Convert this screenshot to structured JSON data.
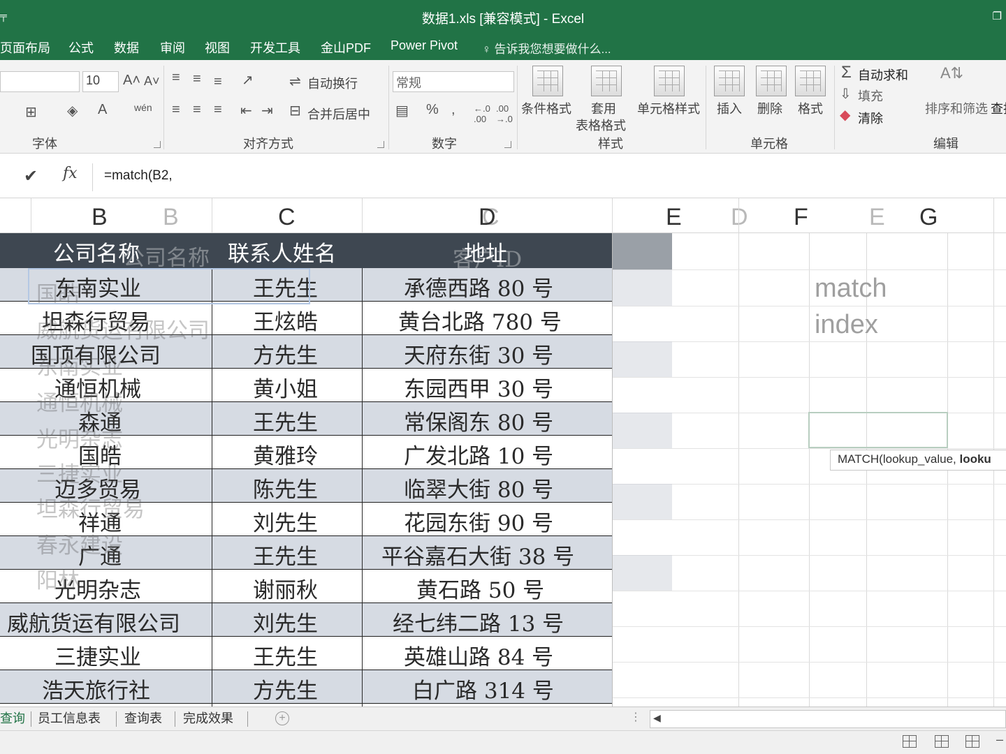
{
  "window": {
    "title": "数据1.xls  [兼容模式] - Excel",
    "left_glyph": "╤",
    "restore_glyph": "❐"
  },
  "menu_tabs": [
    "页面布局",
    "公式",
    "数据",
    "审阅",
    "视图",
    "开发工具",
    "金山PDF",
    "Power Pivot"
  ],
  "tell_me": "告诉我您想要做什么...",
  "ribbon": {
    "font_size": "10",
    "number_format": "常规",
    "wrap_text": "自动换行",
    "merge_center": "合并后居中",
    "cond_format": "条件格式",
    "table_format_1": "套用",
    "table_format_2": "表格格式",
    "cell_styles": "单元格样式",
    "insert": "插入",
    "delete": "删除",
    "format": "格式",
    "autosum": "自动求和",
    "fill": "填充",
    "clear": "清除",
    "sort_filter": "排序和筛选",
    "find": "查找",
    "groups": {
      "font": "字体",
      "alignment": "对齐方式",
      "number": "数字",
      "styles": "样式",
      "cells": "单元格",
      "editing": "编辑"
    }
  },
  "formula_bar": {
    "check": "✔",
    "fx": "fx",
    "formula": "=match(B2,"
  },
  "columns": {
    "B": "B",
    "B_ghost": "B",
    "C": "C",
    "D": "D",
    "C_ghost": "C",
    "E": "E",
    "D_ghost": "D",
    "F": "F",
    "E_ghost": "E",
    "G": "G"
  },
  "table": {
    "headers": {
      "company": "公司名称",
      "company_ghost": "公司名称",
      "contact": "联系人姓名",
      "address": "地址",
      "address_ghost": "客户ID"
    },
    "rows": [
      {
        "company": "东南实业",
        "contact": "王先生",
        "address": "承德西路 80 号"
      },
      {
        "company": "坦森行贸易",
        "contact": "王炫皓",
        "address": "黄台北路 780 号"
      },
      {
        "company": "国顶有限公司",
        "contact": "方先生",
        "address": "天府东街 30 号"
      },
      {
        "company": "通恒机械",
        "contact": "黄小姐",
        "address": "东园西甲 30 号"
      },
      {
        "company": "森通",
        "contact": "王先生",
        "address": "常保阁东 80 号"
      },
      {
        "company": "国皓",
        "contact": "黄雅玲",
        "address": "广发北路 10 号"
      },
      {
        "company": "迈多贸易",
        "contact": "陈先生",
        "address": "临翠大街 80 号"
      },
      {
        "company": "祥通",
        "contact": "刘先生",
        "address": "花园东街 90 号"
      },
      {
        "company": "广通",
        "contact": "王先生",
        "address": "平谷嘉石大街 38 号"
      },
      {
        "company": "光明杂志",
        "contact": "谢丽秋",
        "address": "黄石路 50 号"
      },
      {
        "company": "威航货运有限公司",
        "contact": "刘先生",
        "address": "经七纬二路 13 号"
      },
      {
        "company": "三捷实业",
        "contact": "王先生",
        "address": "英雄山路 84 号"
      },
      {
        "company": "浩天旅行社",
        "contact": "方先生",
        "address": "白广路 314 号"
      }
    ],
    "ghost_companies": [
      "国皓",
      "威航货运有限公司",
      "东南实业",
      "通恒机械",
      "光明杂志",
      "三捷实业",
      "坦森行贸易",
      "春永建设",
      "阳林"
    ]
  },
  "side_notes": {
    "line1": "match",
    "line2": "index"
  },
  "tooltip": {
    "prefix": "MATCH(lookup_value, ",
    "bold": "looku"
  },
  "sheet_tabs": [
    "查询",
    "员工信息表",
    "查询表",
    "完成效果"
  ],
  "add_sheet": "+",
  "scroll_left": "◀",
  "colors": {
    "excel_green": "#217346",
    "header_dark": "#3e4751",
    "band": "#d6dbe3"
  }
}
